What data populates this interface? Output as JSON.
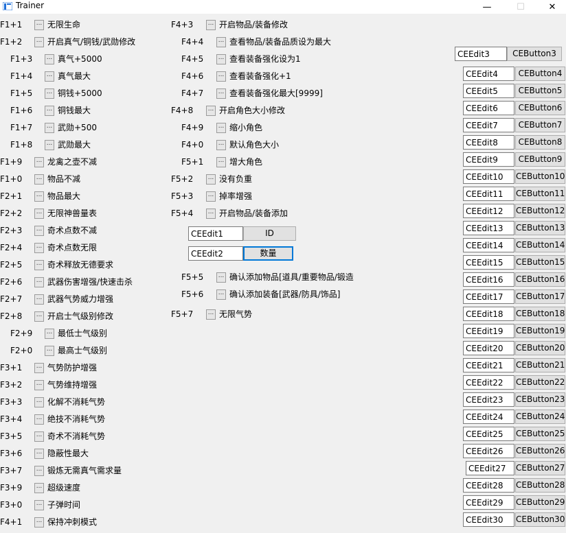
{
  "window": {
    "title": "Trainer",
    "min_glyph": "—",
    "max_glyph": "☐",
    "close_glyph": "✕"
  },
  "checkbox_glyph": "...",
  "col1": [
    {
      "key": "F1+1",
      "label": "无限生命"
    },
    {
      "key": "F1+2",
      "label": "开启真气/铜钱/武勋修改"
    },
    {
      "key": "F1+3",
      "label": "真气+5000"
    },
    {
      "key": "F1+4",
      "label": "真气最大"
    },
    {
      "key": "F1+5",
      "label": "铜钱+5000"
    },
    {
      "key": "F1+6",
      "label": "铜钱最大"
    },
    {
      "key": "F1+7",
      "label": "武勋+500"
    },
    {
      "key": "F1+8",
      "label": "武勋最大"
    },
    {
      "key": "F1+9",
      "label": "龙禽之壶不减"
    },
    {
      "key": "F1+0",
      "label": "物品不减"
    },
    {
      "key": "F2+1",
      "label": "物品最大"
    },
    {
      "key": "F2+2",
      "label": "无限神兽量表"
    },
    {
      "key": "F2+3",
      "label": "奇术点数不减"
    },
    {
      "key": "F2+4",
      "label": "奇术点数无限"
    },
    {
      "key": "F2+5",
      "label": "奇术释放无德要求"
    },
    {
      "key": "F2+6",
      "label": "武器伤害增强/快速击杀"
    },
    {
      "key": "F2+7",
      "label": "武器气势威力增强"
    },
    {
      "key": "F2+8",
      "label": "开启士气级别修改"
    },
    {
      "key": "F2+9",
      "label": "最低士气级别"
    },
    {
      "key": "F2+0",
      "label": "最高士气级别"
    },
    {
      "key": "F3+1",
      "label": "气势防护增强"
    },
    {
      "key": "F3+2",
      "label": "气势维持增强"
    },
    {
      "key": "F3+3",
      "label": "化解不消耗气势"
    },
    {
      "key": "F3+4",
      "label": "绝技不消耗气势"
    },
    {
      "key": "F3+5",
      "label": "奇术不消耗气势"
    },
    {
      "key": "F3+6",
      "label": "隐蔽性最大"
    },
    {
      "key": "F3+7",
      "label": "锻炼无需真气需求量"
    },
    {
      "key": "F3+9",
      "label": "超级速度"
    },
    {
      "key": "F3+0",
      "label": "子弹时间"
    },
    {
      "key": "F4+1",
      "label": "保持冲刺模式"
    }
  ],
  "col2": [
    {
      "key": "F4+3",
      "label": "开启物品/装备修改"
    },
    {
      "key": "F4+4",
      "label": "查看物品/装备品质设为最大"
    },
    {
      "key": "F4+5",
      "label": "查看装备强化设为1"
    },
    {
      "key": "F4+6",
      "label": "查看装备强化+1"
    },
    {
      "key": "F4+7",
      "label": "查看装备强化最大[9999]"
    },
    {
      "key": "F4+8",
      "label": "开启角色大小修改"
    },
    {
      "key": "F4+9",
      "label": "缩小角色"
    },
    {
      "key": "F4+0",
      "label": "默认角色大小"
    },
    {
      "key": "F5+1",
      "label": "增大角色"
    },
    {
      "key": "F5+2",
      "label": "没有负重"
    },
    {
      "key": "F5+3",
      "label": "掉率增强"
    },
    {
      "key": "F5+4",
      "label": "开启物品/装备添加"
    },
    {
      "key": "F5+5",
      "label": "确认添加物品[道具/重要物品/锻造"
    },
    {
      "key": "F5+6",
      "label": "确认添加装备[武器/防具/饰品]"
    },
    {
      "key": "F5+7",
      "label": "无限气势"
    }
  ],
  "add_item": {
    "edit1": "CEEdit1",
    "button1": "ID",
    "edit2": "CEEdit2",
    "button2": "数量"
  },
  "right_pairs": [
    {
      "edit": "CEEdit3",
      "button": "CEButton3"
    },
    {
      "edit": "CEEdit4",
      "button": "CEButton4"
    },
    {
      "edit": "CEEdit5",
      "button": "CEButton5"
    },
    {
      "edit": "CEEdit6",
      "button": "CEButton6"
    },
    {
      "edit": "CEEdit7",
      "button": "CEButton7"
    },
    {
      "edit": "CEEdit8",
      "button": "CEButton8"
    },
    {
      "edit": "CEEdit9",
      "button": "CEButton9"
    },
    {
      "edit": "CEEdit10",
      "button": "CEButton10"
    },
    {
      "edit": "CEEdit11",
      "button": "CEButton11"
    },
    {
      "edit": "CEEdit12",
      "button": "CEButton12"
    },
    {
      "edit": "CEEdit13",
      "button": "CEButton13"
    },
    {
      "edit": "CEEdit14",
      "button": "CEButton14"
    },
    {
      "edit": "CEEdit15",
      "button": "CEButton15"
    },
    {
      "edit": "CEEdit16",
      "button": "CEButton16"
    },
    {
      "edit": "CEEdit17",
      "button": "CEButton17"
    },
    {
      "edit": "CEEdit18",
      "button": "CEButton18"
    },
    {
      "edit": "CEEdit19",
      "button": "CEButton19"
    },
    {
      "edit": "CEEdit20",
      "button": "CEButton20"
    },
    {
      "edit": "CEEdit21",
      "button": "CEButton21"
    },
    {
      "edit": "CEEdit22",
      "button": "CEButton22"
    },
    {
      "edit": "CEEdit23",
      "button": "CEButton23"
    },
    {
      "edit": "CEEdit24",
      "button": "CEButton24"
    },
    {
      "edit": "CEEdit25",
      "button": "CEButton25"
    },
    {
      "edit": "CEEdit26",
      "button": "CEButton26"
    },
    {
      "edit": "CEEdit27",
      "button": "CEButton27"
    },
    {
      "edit": "CEEdit28",
      "button": "CEButton28"
    },
    {
      "edit": "CEEdit29",
      "button": "CEButton29"
    },
    {
      "edit": "CEEdit30",
      "button": "CEButton30"
    }
  ]
}
